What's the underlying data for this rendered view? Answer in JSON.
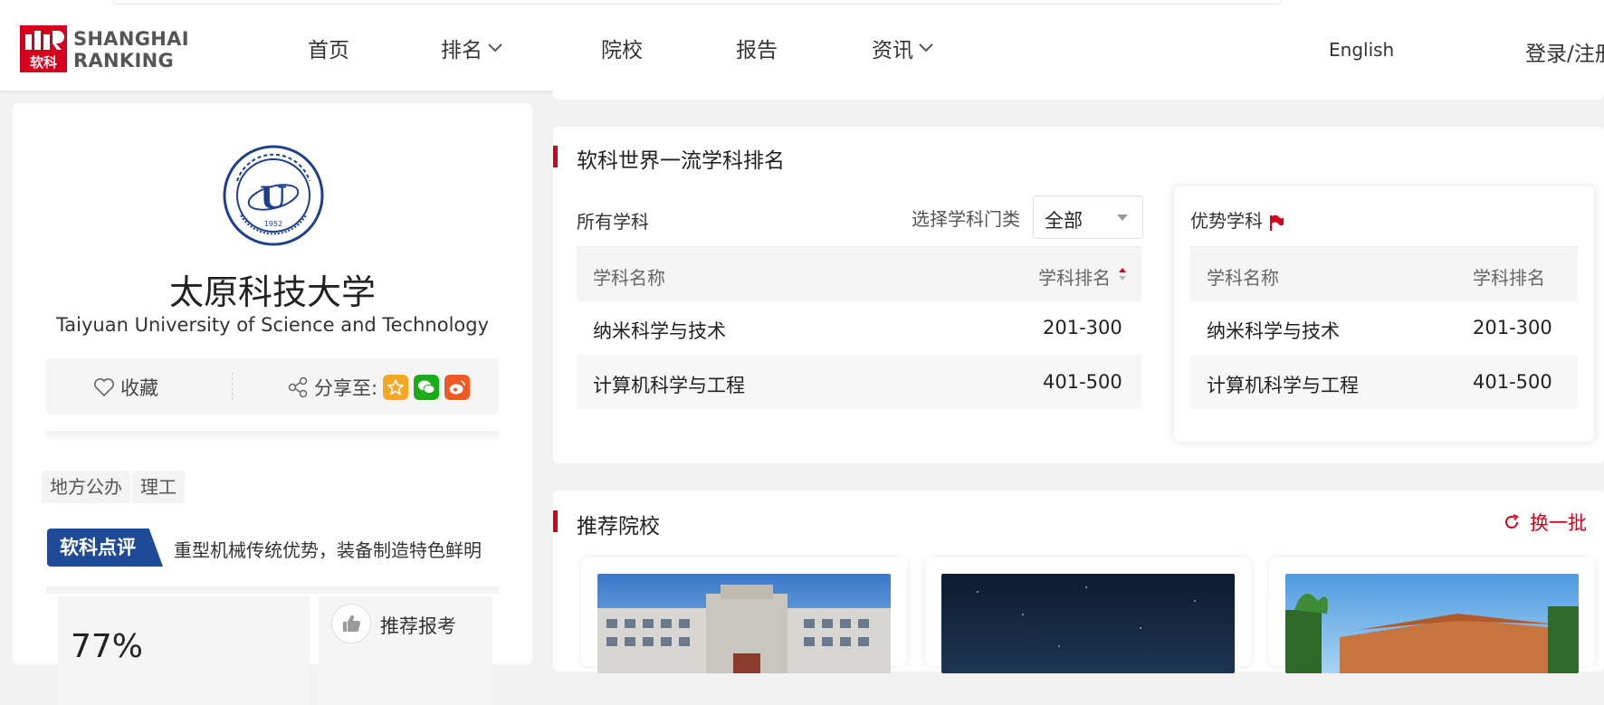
{
  "brand": {
    "logo_mark": "软科",
    "line1": "SHANGHAI",
    "line2": "RANKING",
    "red": "#d6001c"
  },
  "nav": {
    "items": [
      {
        "label": "首页",
        "has_dropdown": false
      },
      {
        "label": "排名",
        "has_dropdown": true
      },
      {
        "label": "院校",
        "has_dropdown": false
      },
      {
        "label": "报告",
        "has_dropdown": false
      },
      {
        "label": "资讯",
        "has_dropdown": true
      }
    ],
    "lang": "English",
    "login": "登录/注册"
  },
  "university": {
    "name_cn": "太原科技大学",
    "name_en": "Taiyuan University of Science and Technology",
    "emblem_letter": "U",
    "emblem_year": "1952",
    "favorite_label": "收藏",
    "share_label": "分享至:",
    "tags": [
      "地方公办",
      "理工"
    ],
    "review_badge": "软科点评",
    "review_text": "重型机械传统优势，装备制造特色鲜明",
    "recommend_pct": "77%",
    "recommend_label": "推荐报考"
  },
  "subject_ranking": {
    "title": "软科世界一流学科排名",
    "all_label": "所有学科",
    "select_label": "选择学科门类",
    "select_value": "全部",
    "col_name": "学科名称",
    "col_rank": "学科排名",
    "rows": [
      {
        "name": "纳米科学与技术",
        "rank": "201-300"
      },
      {
        "name": "计算机科学与工程",
        "rank": "401-500"
      }
    ],
    "advantage": {
      "title": "优势学科",
      "col_name": "学科名称",
      "col_rank": "学科排名",
      "rows": [
        {
          "name": "纳米科学与技术",
          "rank": "201-300"
        },
        {
          "name": "计算机科学与工程",
          "rank": "401-500"
        }
      ]
    }
  },
  "recommended": {
    "title": "推荐院校",
    "refresh_label": "换一批"
  }
}
